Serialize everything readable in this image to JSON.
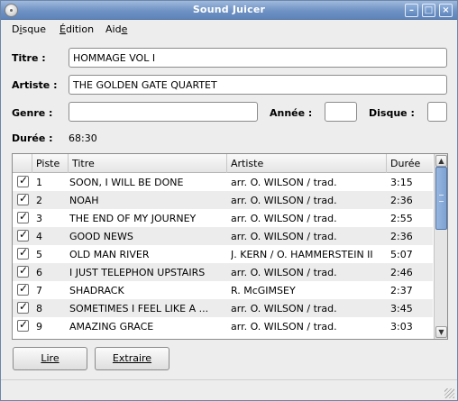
{
  "window": {
    "title": "Sound Juicer"
  },
  "menu": [
    {
      "label": "Disque",
      "mnemonic_index": 1
    },
    {
      "label": "Édition",
      "mnemonic_index": 0
    },
    {
      "label": "Aide",
      "mnemonic_index": 3
    }
  ],
  "form": {
    "titre_label": "Titre :",
    "titre_value": "HOMMAGE VOL I",
    "artiste_label": "Artiste :",
    "artiste_value": "THE GOLDEN GATE QUARTET",
    "genre_label": "Genre :",
    "genre_value": "",
    "annee_label": "Année :",
    "annee_value": "",
    "disque_label": "Disque :",
    "disque_value": "",
    "duree_label": "Durée :",
    "duree_value": "68:30"
  },
  "tracklist": {
    "columns": [
      "",
      "Piste",
      "Titre",
      "Artiste",
      "Durée"
    ],
    "rows": [
      {
        "checked": true,
        "num": "1",
        "title": "SOON, I WILL BE DONE",
        "artist": "arr. O. WILSON / trad.",
        "duration": "3:15"
      },
      {
        "checked": true,
        "num": "2",
        "title": "NOAH",
        "artist": "arr. O. WILSON / trad.",
        "duration": "2:36"
      },
      {
        "checked": true,
        "num": "3",
        "title": "THE END OF MY JOURNEY",
        "artist": "arr. O. WILSON / trad.",
        "duration": "2:55"
      },
      {
        "checked": true,
        "num": "4",
        "title": "GOOD NEWS",
        "artist": "arr. O. WILSON / trad.",
        "duration": "2:36"
      },
      {
        "checked": true,
        "num": "5",
        "title": "OLD MAN RIVER",
        "artist": "J. KERN / O. HAMMERSTEIN II",
        "duration": "5:07"
      },
      {
        "checked": true,
        "num": "6",
        "title": "I JUST TELEPHON UPSTAIRS",
        "artist": "arr. O. WILSON / trad.",
        "duration": "2:46"
      },
      {
        "checked": true,
        "num": "7",
        "title": "SHADRACK",
        "artist": "R. McGIMSEY",
        "duration": "2:37"
      },
      {
        "checked": true,
        "num": "8",
        "title": "SOMETIMES I FEEL LIKE A ...",
        "artist": "arr. O. WILSON / trad.",
        "duration": "3:45"
      },
      {
        "checked": true,
        "num": "9",
        "title": "AMAZING GRACE",
        "artist": "arr. O. WILSON / trad.",
        "duration": "3:03"
      }
    ]
  },
  "buttons": {
    "play_label": "Lire",
    "extract_label": "Extraire"
  },
  "icons": {
    "app": "cd-icon",
    "scroll_up": "arrow-up-icon",
    "scroll_down": "arrow-down-icon"
  },
  "colors": {
    "titlebar": "#6f92c3",
    "scroll_thumb": "#7ea2d3"
  }
}
